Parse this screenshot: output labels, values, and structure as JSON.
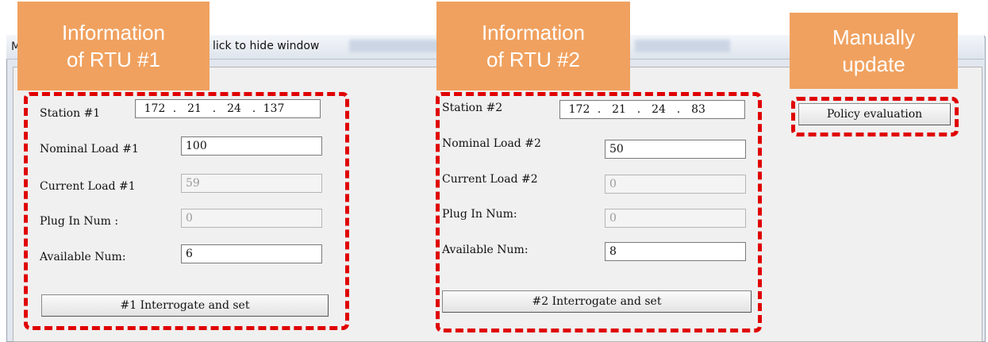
{
  "window": {
    "title_prefix": "M",
    "title": "lick to hide window"
  },
  "callouts": {
    "rtu1": [
      "Information",
      "of RTU #1"
    ],
    "rtu2": [
      "Information",
      "of RTU #2"
    ],
    "manual": [
      "Manually",
      "update"
    ]
  },
  "rtu1": {
    "station_label": "Station #1",
    "ip": [
      "172",
      "21",
      "24",
      "137"
    ],
    "nominal_label": "Nominal Load #1",
    "nominal_value": "100",
    "current_label": "Current Load #1",
    "current_value": "59",
    "plug_label": "Plug In Num :",
    "plug_value": "0",
    "available_label": "Available Num:",
    "available_value": "6",
    "button_label": "#1 Interrogate and set"
  },
  "rtu2": {
    "station_label": "Station #2",
    "ip": [
      "172",
      "21",
      "24",
      "83"
    ],
    "nominal_label": "Nominal Load #2",
    "nominal_value": "50",
    "current_label": "Current Load #2",
    "current_value": "0",
    "plug_label": "Plug In Num:",
    "plug_value": "0",
    "available_label": "Available Num:",
    "available_value": "8",
    "button_label": "#2 Interrogate and set"
  },
  "policy": {
    "button_label": "Policy evaluation"
  },
  "colors": {
    "callout_bg": "#f0a15f",
    "highlight_dash": "#e00000"
  }
}
